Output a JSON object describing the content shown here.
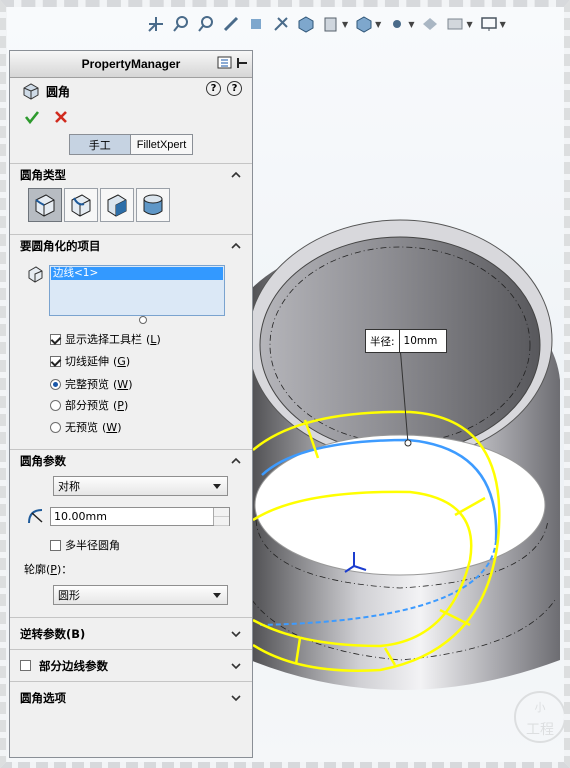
{
  "toolbar": {
    "icons": [
      "zoom-fit-icon",
      "zoom-area-icon",
      "zoom-prev-icon",
      "section-view-icon",
      "view-orient-icon",
      "display-style-icon",
      "hide-show-icon",
      "apply-scene-icon",
      "view-settings-icon",
      "monitor-icon"
    ]
  },
  "property_manager": {
    "title": "PropertyManager",
    "feature_name": "圆角",
    "tabs": {
      "manual": "手工",
      "filletxpert": "FilletXpert"
    },
    "fillet_type": {
      "heading": "圆角类型",
      "options": [
        "constant-size",
        "variable-size",
        "face-fillet",
        "full-round"
      ],
      "selected": 0
    },
    "items": {
      "heading": "要圆角化的项目",
      "selection": [
        "边线<1>"
      ],
      "show_toolbar": "显示选择工具栏",
      "show_toolbar_key": "L",
      "tangent": "切线延伸",
      "tangent_key": "G",
      "full_preview": "完整预览",
      "full_preview_key": "W",
      "partial_preview": "部分预览",
      "partial_preview_key": "P",
      "no_preview": "无预览",
      "no_preview_key": "W"
    },
    "params": {
      "heading": "圆角参数",
      "method": "对称",
      "radius": "10.00mm",
      "multi_radius": "多半径圆角",
      "profile_label": "轮廓",
      "profile_key": "P",
      "profile": "圆形"
    },
    "reverse_params": "逆转参数",
    "reverse_key": "B",
    "partial_edge": "部分边线参数",
    "fillet_options": "圆角选项"
  },
  "callout": {
    "key": "半径:",
    "value": "10mm"
  },
  "watermark": {
    "line1": "小",
    "line2": "工程师"
  },
  "colors": {
    "highlight": "#ffff00",
    "selected_edge": "#3d9bff",
    "accent": "#3399ff"
  }
}
